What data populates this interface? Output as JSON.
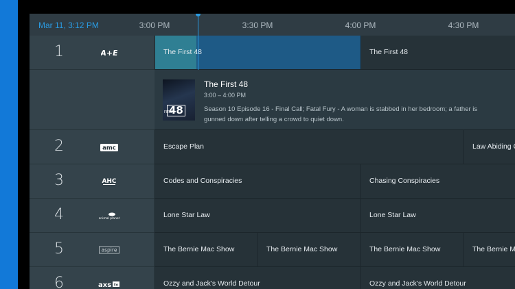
{
  "header": {
    "current": "Mar 11, 3:12 PM",
    "slots": [
      "3:00 PM",
      "3:30 PM",
      "4:00 PM",
      "4:30 PM"
    ]
  },
  "progress": {
    "current_program_elapsed_fraction": 0.2
  },
  "channels": [
    {
      "number": "1",
      "logo": "A+E",
      "logo_icon": "ae-logo-icon",
      "programs": [
        "The First 48",
        "The First 48"
      ]
    },
    {
      "number": "2",
      "logo": "amc",
      "logo_icon": "amc-logo-icon",
      "programs": [
        "Escape Plan",
        "Law Abiding Ci"
      ]
    },
    {
      "number": "3",
      "logo": "AHC",
      "logo_icon": "ahc-logo-icon",
      "programs": [
        "Codes and Conspiracies",
        "Chasing Conspiracies"
      ]
    },
    {
      "number": "4",
      "logo": "animal planet",
      "logo_icon": "animal-planet-logo-icon",
      "programs": [
        "Lone Star Law",
        "Lone Star Law"
      ]
    },
    {
      "number": "5",
      "logo": "aspire",
      "logo_icon": "aspire-logo-icon",
      "programs": [
        "The Bernie Mac Show",
        "The Bernie Mac Show",
        "The Bernie Mac Show",
        "The Bernie Ma"
      ]
    },
    {
      "number": "6",
      "logo": "AXS TV",
      "logo_icon": "axs-tv-logo-icon",
      "programs": [
        "Ozzy and Jack's World Detour",
        "Ozzy and Jack's World Detour"
      ]
    }
  ],
  "detail": {
    "title": "The First 48",
    "time": "3:00 – 4:00 PM",
    "description": "Season 10 Episode 16 - Final Call; Fatal Fury - A woman is stabbed in her bedroom; a father is gunned down after telling a crowd to quiet down.",
    "poster_prefix": "FIRST",
    "poster_text": "48"
  },
  "colors": {
    "accent": "#2a9ae0",
    "sidebar": "#1279d8",
    "selected": "#2f7f93",
    "focus": "#1e5a86"
  }
}
